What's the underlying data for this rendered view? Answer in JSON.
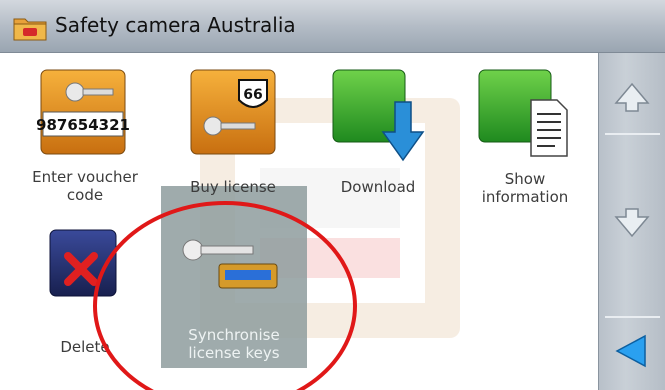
{
  "header": {
    "title": "Safety camera Australia",
    "icon": "folder-icon"
  },
  "items": [
    {
      "label_lines": [
        "Enter voucher",
        "code"
      ],
      "icon": "voucher-key-icon",
      "voucher_code": "987654321"
    },
    {
      "label_lines": [
        "Buy license"
      ],
      "icon": "buy-license-key-icon",
      "badge": "66"
    },
    {
      "label_lines": [
        "Download"
      ],
      "icon": "download-icon"
    },
    {
      "label_lines": [
        "Show",
        "information"
      ],
      "icon": "show-information-icon"
    },
    {
      "label_lines": [
        "Delete"
      ],
      "icon": "delete-icon"
    },
    {
      "label_lines": [
        "Synchronise",
        "license keys"
      ],
      "icon": "synchronise-keys-icon",
      "selected": true
    }
  ],
  "scrollbar": {
    "up_icon": "arrow-up-icon",
    "down_icon": "arrow-down-icon",
    "back_icon": "back-arrow-icon"
  },
  "colors": {
    "accent_blue": "#2a8fd8",
    "annotation_red": "#e01818"
  }
}
